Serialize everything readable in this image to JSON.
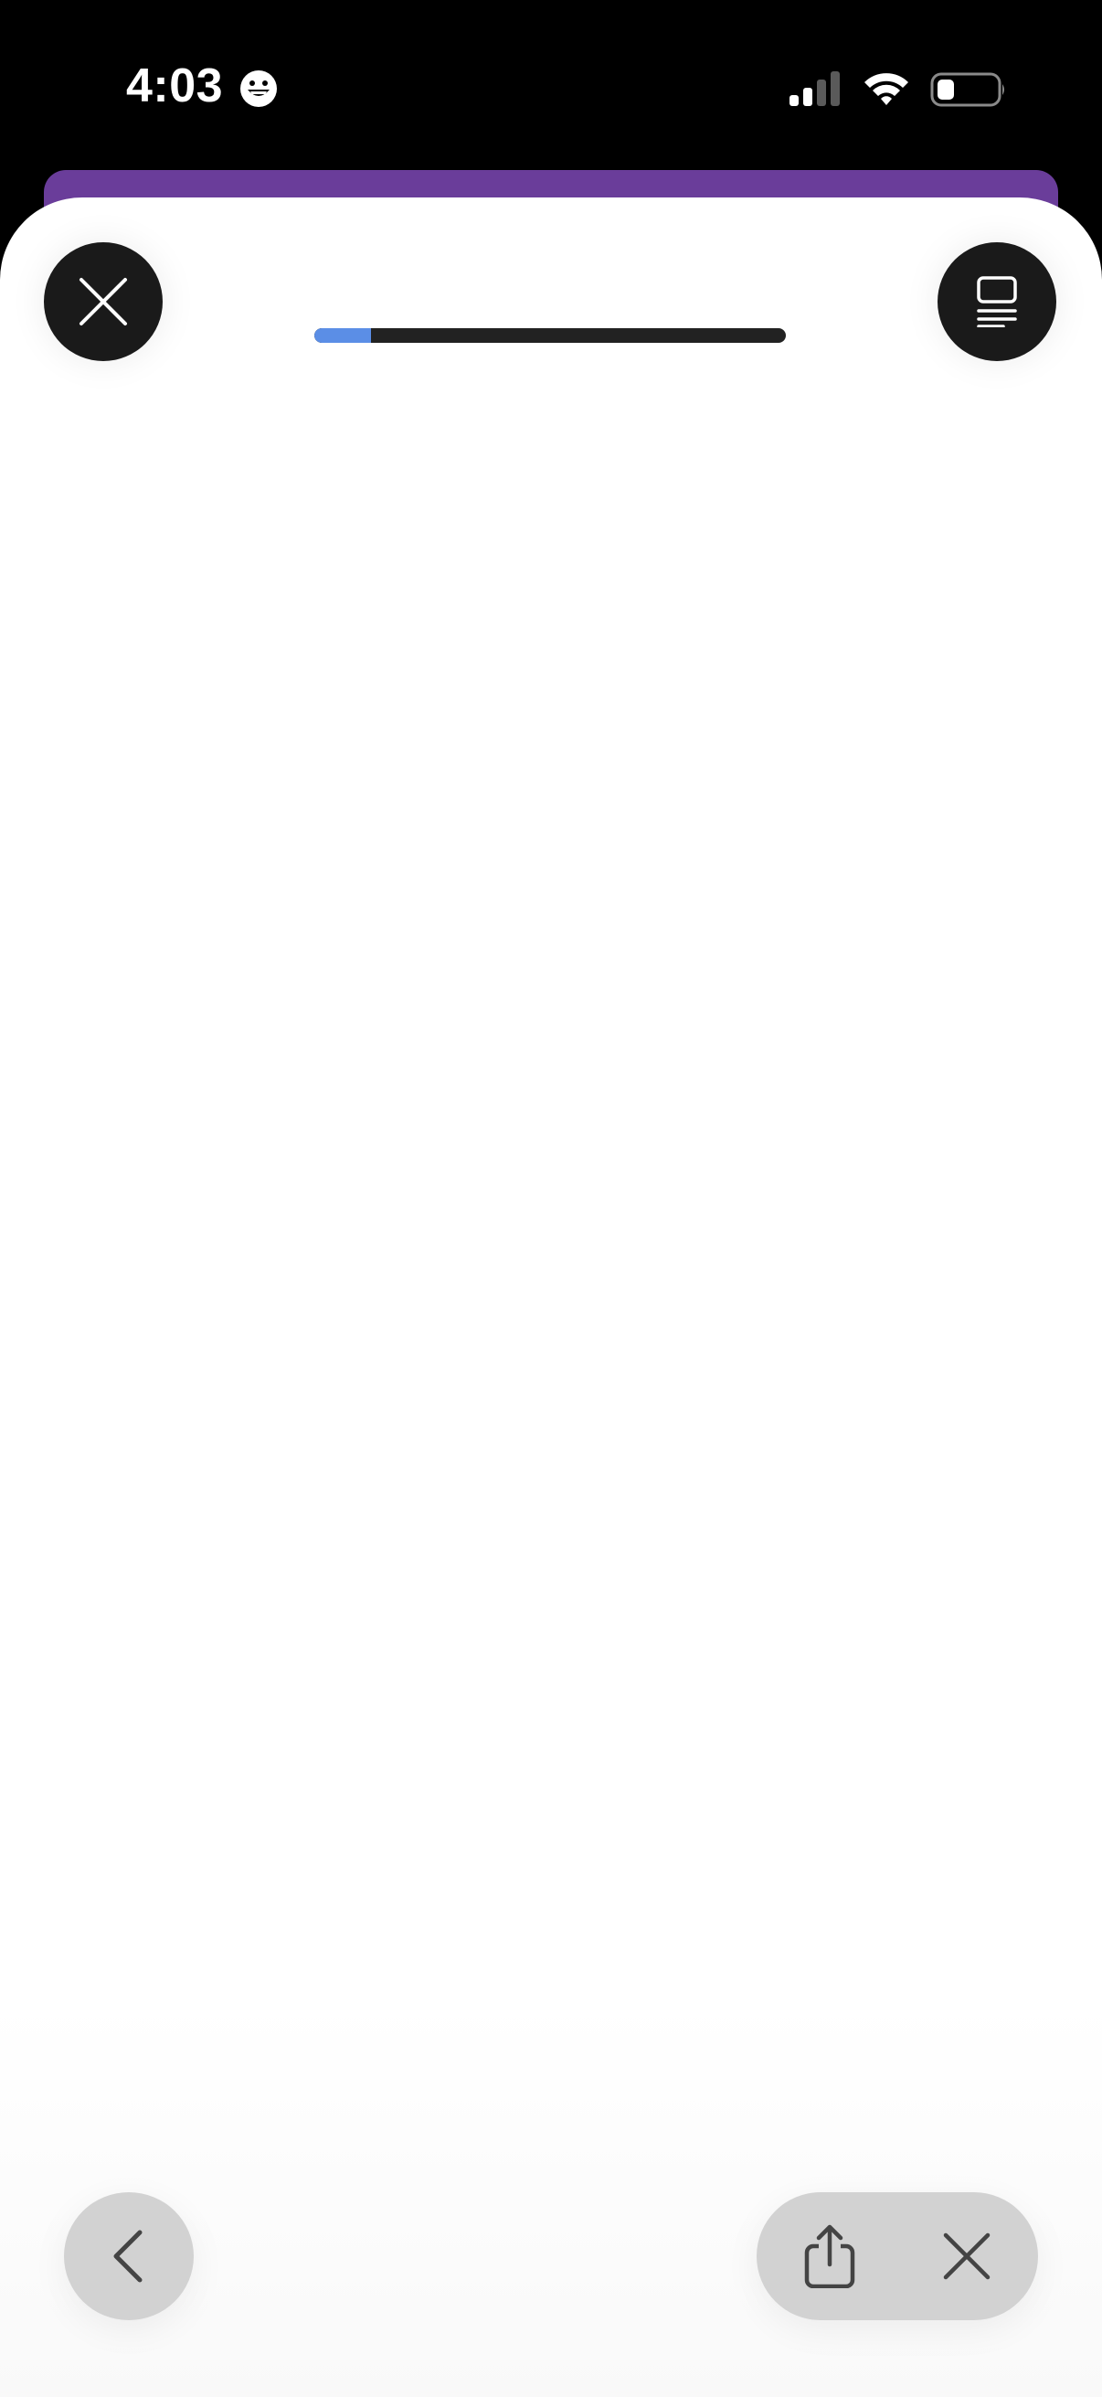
{
  "status_bar": {
    "time": "4:03",
    "status_emoji_icon": "grinning-face-icon",
    "signal_icon": "cellular-signal-icon",
    "wifi_icon": "wifi-icon",
    "battery_icon": "battery-low-icon"
  },
  "header": {
    "close_icon": "close-icon",
    "menu_icon": "reader-menu-icon"
  },
  "loading": {
    "progress_fraction": 0.12
  },
  "toolbar": {
    "back_icon": "chevron-left-icon",
    "share_icon": "share-icon",
    "close_icon": "close-icon"
  },
  "colors": {
    "accent_purple": "#6a3d9a",
    "progress_fill": "#5b8ee6",
    "progress_track": "#222222",
    "button_dark": "#1a1a1a",
    "toolbar_button": "#d2d2d2"
  }
}
